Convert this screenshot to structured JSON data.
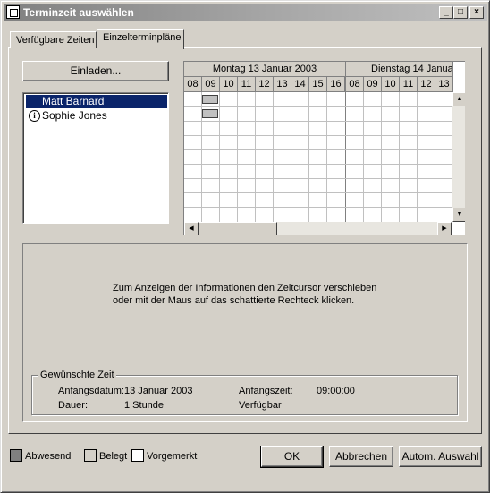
{
  "window": {
    "title": "Terminzeit auswählen",
    "controls": {
      "minimize": "_",
      "maximize": "□",
      "close": "×"
    }
  },
  "tabs": [
    {
      "label": "Verfügbare Zeiten",
      "active": false
    },
    {
      "label": "Einzelterminpläne",
      "active": true
    }
  ],
  "invite_button": "Einladen...",
  "attendees": [
    {
      "name": "Matt Barnard",
      "selected": true,
      "icon": null
    },
    {
      "name": "Sophie Jones",
      "selected": false,
      "icon": "info-icon"
    }
  ],
  "schedule": {
    "days": [
      "Montag 13 Januar 2003",
      "Dienstag 14 Januar 2003"
    ],
    "hours_day1": [
      "08",
      "09",
      "10",
      "11",
      "12",
      "13",
      "14",
      "15",
      "16"
    ],
    "hours_day2": [
      "08",
      "09",
      "10",
      "11",
      "12",
      "13"
    ],
    "busy_colors": {
      "busy": "#c0c0c0",
      "absent": "#808080",
      "tentative": "#ffffff"
    }
  },
  "info": {
    "line1": "Zum Anzeigen der Informationen den Zeitcursor verschieben",
    "line2": "oder mit der Maus auf das schattierte Rechteck klicken."
  },
  "requested_time": {
    "group_label": "Gewünschte Zeit",
    "start_date_label": "Anfangsdatum:",
    "start_date_value": "13 Januar 2003",
    "start_time_label": "Anfangszeit:",
    "start_time_value": "09:00:00",
    "duration_label": "Dauer:",
    "duration_value": "1 Stunde",
    "status_value": "Verfügbar"
  },
  "legend": {
    "absent": "Abwesend",
    "busy": "Belegt",
    "tentative": "Vorgemerkt"
  },
  "buttons": {
    "ok": "OK",
    "cancel": "Abbrechen",
    "auto": "Autom. Auswahl"
  }
}
